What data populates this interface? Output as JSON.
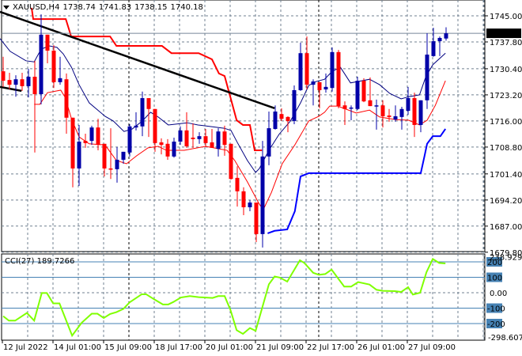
{
  "header": {
    "symbol": "XAUUSD,H4",
    "open": "1738.74",
    "high": "1741.83",
    "low": "1738.15",
    "close": "1740.18"
  },
  "cci_header": {
    "name": "CCI(27)",
    "value": "189.7266"
  },
  "colors": {
    "bull": "#0000a8",
    "bear": "#ff0000",
    "upper_band": "#ff0000",
    "trendline": "#000000",
    "ma_fast": "#000080",
    "ma_slow": "#ff0000",
    "stop_line": "#0000ff",
    "cci_line": "#7fff00",
    "cci_level": "#4682b4",
    "grid": "#708090"
  },
  "chart_data": [
    {
      "type": "candlestick",
      "title": "XAUUSD,H4",
      "ylim": [
        1679.8,
        1745.0
      ],
      "price_ticks": [
        "1745.00",
        "1737.80",
        "1730.40",
        "1723.20",
        "1716.00",
        "1708.80",
        "1701.40",
        "1694.20",
        "1687.00",
        "1679.80"
      ],
      "last_price": "1740.18",
      "x_labels": [
        "12 Jul 2022",
        "14 Jul 01:00",
        "15 Jul 09:00",
        "18 Jul 17:00",
        "20 Jul 01:00",
        "21 Jul 09:00",
        "22 Jul 17:00",
        "26 Jul 01:00",
        "27 Jul 09:00"
      ],
      "x_label_index": [
        0,
        8,
        16,
        24,
        32,
        40,
        48,
        56,
        64
      ],
      "ohlc": [
        [
          1729.7,
          1733.7,
          1725.4,
          1727.1
        ],
        [
          1727.3,
          1729.3,
          1724.7,
          1726.0
        ],
        [
          1726.0,
          1728.6,
          1722.7,
          1727.5
        ],
        [
          1727.5,
          1729.3,
          1724.3,
          1725.6
        ],
        [
          1725.6,
          1730.4,
          1722.5,
          1728.2
        ],
        [
          1728.2,
          1732.6,
          1707.3,
          1723.4
        ],
        [
          1723.4,
          1745.4,
          1720.6,
          1739.8
        ],
        [
          1739.8,
          1739.8,
          1731.9,
          1735.4
        ],
        [
          1735.4,
          1736.9,
          1725.1,
          1726.7
        ],
        [
          1726.7,
          1733.7,
          1726.0,
          1727.8
        ],
        [
          1727.5,
          1729.1,
          1712.5,
          1716.9
        ],
        [
          1716.9,
          1716.9,
          1697.7,
          1702.9
        ],
        [
          1702.9,
          1714.9,
          1698.1,
          1710.3
        ],
        [
          1710.5,
          1712.5,
          1708.6,
          1709.9
        ],
        [
          1710.5,
          1714.7,
          1709.4,
          1714.2
        ],
        [
          1714.2,
          1716.6,
          1707.9,
          1709.4
        ],
        [
          1709.7,
          1709.7,
          1700.7,
          1702.9
        ],
        [
          1702.9,
          1714.0,
          1700.0,
          1702.7
        ],
        [
          1702.7,
          1708.8,
          1699.0,
          1705.3
        ],
        [
          1705.3,
          1707.5,
          1704.2,
          1707.5
        ],
        [
          1707.3,
          1715.1,
          1706.2,
          1714.5
        ],
        [
          1714.2,
          1718.4,
          1713.4,
          1714.7
        ],
        [
          1714.5,
          1724.1,
          1711.8,
          1722.3
        ],
        [
          1722.3,
          1722.3,
          1711.6,
          1719.3
        ],
        [
          1719.3,
          1719.3,
          1707.5,
          1709.9
        ],
        [
          1710.1,
          1711.2,
          1706.8,
          1709.4
        ],
        [
          1709.7,
          1711.0,
          1705.3,
          1706.2
        ],
        [
          1706.2,
          1711.4,
          1705.9,
          1710.3
        ],
        [
          1710.3,
          1714.5,
          1709.4,
          1713.4
        ],
        [
          1713.4,
          1718.4,
          1708.6,
          1709.0
        ],
        [
          1711.4,
          1715.3,
          1708.6,
          1711.0
        ],
        [
          1711.0,
          1712.9,
          1709.7,
          1711.8
        ],
        [
          1711.8,
          1713.8,
          1708.8,
          1709.9
        ],
        [
          1710.1,
          1713.8,
          1708.6,
          1708.6
        ],
        [
          1708.3,
          1714.0,
          1706.2,
          1713.1
        ],
        [
          1713.1,
          1714.7,
          1706.4,
          1709.4
        ],
        [
          1709.7,
          1709.7,
          1699.8,
          1700.0
        ],
        [
          1700.3,
          1703.5,
          1692.4,
          1696.6
        ],
        [
          1696.6,
          1697.7,
          1690.0,
          1692.2
        ],
        [
          1692.2,
          1694.2,
          1691.1,
          1693.5
        ],
        [
          1693.5,
          1693.5,
          1682.6,
          1684.8
        ],
        [
          1684.8,
          1710.5,
          1681.1,
          1706.2
        ],
        [
          1706.2,
          1718.6,
          1703.8,
          1714.0
        ],
        [
          1713.8,
          1720.3,
          1713.6,
          1718.6
        ],
        [
          1717.9,
          1719.5,
          1716.0,
          1716.6
        ],
        [
          1717.1,
          1717.3,
          1712.9,
          1716.0
        ],
        [
          1716.0,
          1725.8,
          1715.1,
          1724.5
        ],
        [
          1724.5,
          1737.6,
          1724.3,
          1734.7
        ],
        [
          1734.7,
          1739.3,
          1724.7,
          1726.0
        ],
        [
          1726.0,
          1727.5,
          1720.3,
          1726.9
        ],
        [
          1726.7,
          1726.7,
          1719.5,
          1724.5
        ],
        [
          1724.7,
          1729.1,
          1723.8,
          1725.4
        ],
        [
          1725.1,
          1736.3,
          1724.1,
          1735.0
        ],
        [
          1735.0,
          1735.6,
          1719.5,
          1720.1
        ],
        [
          1720.3,
          1721.4,
          1714.9,
          1719.3
        ],
        [
          1719.5,
          1720.3,
          1716.2,
          1719.7
        ],
        [
          1719.3,
          1728.2,
          1719.0,
          1727.1
        ],
        [
          1727.1,
          1727.8,
          1721.2,
          1721.4
        ],
        [
          1721.7,
          1728.0,
          1720.1,
          1720.1
        ],
        [
          1720.1,
          1721.9,
          1713.6,
          1720.3
        ],
        [
          1720.3,
          1721.7,
          1714.2,
          1717.3
        ],
        [
          1717.5,
          1719.3,
          1715.8,
          1717.1
        ],
        [
          1716.4,
          1720.3,
          1715.8,
          1717.3
        ],
        [
          1717.1,
          1719.9,
          1713.6,
          1719.3
        ],
        [
          1718.8,
          1725.4,
          1717.7,
          1722.3
        ],
        [
          1722.3,
          1723.8,
          1711.6,
          1714.9
        ],
        [
          1714.9,
          1721.7,
          1712.9,
          1721.7
        ],
        [
          1721.7,
          1740.2,
          1719.3,
          1734.3
        ],
        [
          1733.9,
          1741.7,
          1733.7,
          1738.0
        ],
        [
          1738.0,
          1739.3,
          1733.9,
          1738.9
        ],
        [
          1738.74,
          1741.83,
          1738.15,
          1740.18
        ]
      ],
      "overlays": {
        "upper_band": [
          [
            4.5,
            1747.2
          ],
          [
            4.75,
            1744.1
          ],
          [
            9.9,
            1744.1
          ],
          [
            10.75,
            1739.3
          ],
          [
            16.9,
            1739.3
          ],
          [
            17.9,
            1736.7
          ],
          [
            25.1,
            1736.7
          ],
          [
            26.6,
            1734.7
          ],
          [
            30.9,
            1734.7
          ],
          [
            33,
            1733.0
          ],
          [
            34.1,
            1729.1
          ],
          [
            35,
            1728.4
          ],
          [
            35.75,
            1723.6
          ],
          [
            36.9,
            1716.2
          ],
          [
            37.9,
            1714.9
          ],
          [
            39,
            1714.9
          ],
          [
            39.75,
            1707.9
          ],
          [
            40.9,
            1707.9
          ]
        ],
        "trendline": [
          [
            -0.5,
            1746.1
          ],
          [
            42.9,
            1719.5
          ]
        ],
        "trendline_short": [
          [
            -0.5,
            1725.4
          ],
          [
            2.9,
            1724.3
          ]
        ],
        "ma_fast": [
          [
            -0.5,
            1738.7
          ],
          [
            1.1,
            1735.2
          ],
          [
            3.6,
            1732.6
          ],
          [
            4.9,
            1732.3
          ],
          [
            6.0,
            1735.8
          ],
          [
            7.3,
            1736.7
          ],
          [
            8.5,
            1736.3
          ],
          [
            9.5,
            1734.5
          ],
          [
            10.8,
            1730.8
          ],
          [
            12.0,
            1726.0
          ],
          [
            13.6,
            1721.0
          ],
          [
            16.1,
            1717.3
          ],
          [
            17.4,
            1716.0
          ],
          [
            19.1,
            1713.1
          ],
          [
            20.4,
            1713.8
          ],
          [
            22.0,
            1716.0
          ],
          [
            23.3,
            1718.4
          ],
          [
            24.5,
            1717.1
          ],
          [
            26.1,
            1714.9
          ],
          [
            29.1,
            1715.5
          ],
          [
            30.8,
            1714.9
          ],
          [
            34.9,
            1714.0
          ],
          [
            36.0,
            1713.4
          ],
          [
            37.0,
            1710.1
          ],
          [
            38.6,
            1705.1
          ],
          [
            39.9,
            1701.8
          ],
          [
            40.5,
            1702.9
          ],
          [
            42.0,
            1707.9
          ],
          [
            43.6,
            1712.3
          ],
          [
            45.4,
            1716.0
          ],
          [
            47.0,
            1721.0
          ],
          [
            48.3,
            1725.8
          ],
          [
            49.5,
            1726.9
          ],
          [
            50.8,
            1727.5
          ],
          [
            52.0,
            1729.7
          ],
          [
            53.3,
            1730.8
          ],
          [
            54.9,
            1726.5
          ],
          [
            56.1,
            1726.9
          ],
          [
            57.9,
            1727.5
          ],
          [
            59.5,
            1726.0
          ],
          [
            61.1,
            1723.6
          ],
          [
            62.9,
            1722.1
          ],
          [
            64.1,
            1722.7
          ],
          [
            65.8,
            1723.2
          ],
          [
            66.8,
            1728.2
          ],
          [
            67.9,
            1731.5
          ],
          [
            69.9,
            1734.7
          ]
        ],
        "ma_slow": [
          [
            4.9,
            1720.6
          ],
          [
            5.8,
            1720.6
          ],
          [
            7.0,
            1723.8
          ],
          [
            9.1,
            1724.5
          ],
          [
            9.8,
            1722.5
          ],
          [
            10.8,
            1716.6
          ],
          [
            12.0,
            1711.6
          ],
          [
            13.6,
            1709.7
          ],
          [
            16.1,
            1709.4
          ],
          [
            17.9,
            1705.1
          ],
          [
            19.5,
            1704.2
          ],
          [
            21.1,
            1706.4
          ],
          [
            22.9,
            1708.6
          ],
          [
            24.5,
            1709.0
          ],
          [
            25.8,
            1707.9
          ],
          [
            28.6,
            1707.9
          ],
          [
            32.0,
            1709.0
          ],
          [
            35.4,
            1707.9
          ],
          [
            36.6,
            1705.1
          ],
          [
            38.6,
            1699.2
          ],
          [
            40.4,
            1693.3
          ],
          [
            41.1,
            1691.5
          ],
          [
            42.4,
            1696.3
          ],
          [
            44.1,
            1704.2
          ],
          [
            46.1,
            1709.4
          ],
          [
            48.3,
            1716.0
          ],
          [
            49.9,
            1717.3
          ],
          [
            50.8,
            1718.4
          ],
          [
            51.6,
            1720.1
          ],
          [
            52.9,
            1720.1
          ],
          [
            55.8,
            1718.2
          ],
          [
            57.9,
            1719.0
          ],
          [
            59.5,
            1717.1
          ],
          [
            62.0,
            1716.4
          ],
          [
            64.1,
            1716.2
          ],
          [
            65.8,
            1714.9
          ],
          [
            67.0,
            1716.2
          ],
          [
            68.3,
            1720.3
          ],
          [
            69.9,
            1727.1
          ]
        ],
        "stop_line": [
          [
            41.8,
            1685.0
          ],
          [
            42.9,
            1685.7
          ],
          [
            44.9,
            1686.1
          ],
          [
            46.1,
            1691.1
          ],
          [
            47.0,
            1700.7
          ],
          [
            48.3,
            1701.6
          ],
          [
            66.0,
            1701.6
          ],
          [
            66.6,
            1706.4
          ],
          [
            67.0,
            1709.7
          ],
          [
            67.9,
            1711.8
          ],
          [
            69.1,
            1711.8
          ],
          [
            69.9,
            1713.8
          ]
        ]
      }
    },
    {
      "type": "line",
      "title": "CCI(27)",
      "ylim": [
        -298.6071,
        238.9292
      ],
      "levels": [
        "200",
        "100",
        "0.00",
        "-100",
        "-200"
      ],
      "level_values": [
        200,
        100,
        0,
        -100,
        -200
      ],
      "max_label": "238.9292",
      "min_label": "-298.6071",
      "series": [
        [
          0,
          -152
        ],
        [
          0.9,
          -181
        ],
        [
          1.9,
          -181
        ],
        [
          3.75,
          -131
        ],
        [
          4.9,
          -181
        ],
        [
          6.1,
          -2
        ],
        [
          6.9,
          -2
        ],
        [
          7.9,
          -69
        ],
        [
          8.9,
          -69
        ],
        [
          10.9,
          -278
        ],
        [
          12.4,
          -195
        ],
        [
          14,
          -136
        ],
        [
          14.9,
          -136
        ],
        [
          15.9,
          -164
        ],
        [
          16.9,
          -138
        ],
        [
          17.9,
          -126
        ],
        [
          19,
          -105
        ],
        [
          20,
          -62
        ],
        [
          21.9,
          -10
        ],
        [
          22.6,
          -10
        ],
        [
          23.75,
          -40
        ],
        [
          25.25,
          -76
        ],
        [
          26.1,
          -76
        ],
        [
          26.9,
          -60
        ],
        [
          28.1,
          -31
        ],
        [
          29.5,
          -22
        ],
        [
          30.9,
          -29
        ],
        [
          33.1,
          -34
        ],
        [
          34,
          -22
        ],
        [
          35,
          -22
        ],
        [
          35.9,
          -109
        ],
        [
          36.9,
          -243
        ],
        [
          37.9,
          -267
        ],
        [
          39,
          -229
        ],
        [
          39.9,
          -247
        ],
        [
          42,
          55
        ],
        [
          42.9,
          105
        ],
        [
          43.75,
          98
        ],
        [
          44.9,
          72
        ],
        [
          46.9,
          210
        ],
        [
          47.6,
          193
        ],
        [
          49,
          129
        ],
        [
          49.9,
          116
        ],
        [
          50.9,
          121
        ],
        [
          51.9,
          150
        ],
        [
          53.9,
          40
        ],
        [
          55,
          40
        ],
        [
          56.1,
          69
        ],
        [
          57.9,
          53
        ],
        [
          59,
          19
        ],
        [
          60,
          12
        ],
        [
          61.9,
          10
        ],
        [
          62.9,
          5
        ],
        [
          64,
          36
        ],
        [
          64.75,
          -12
        ],
        [
          65.9,
          0
        ],
        [
          66.9,
          133
        ],
        [
          67.9,
          219
        ],
        [
          68.9,
          193
        ],
        [
          69.9,
          190
        ]
      ]
    }
  ]
}
